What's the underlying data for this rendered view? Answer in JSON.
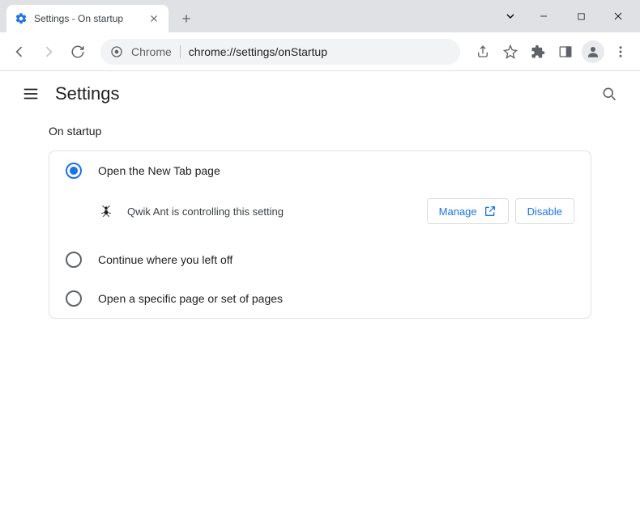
{
  "window": {
    "tab_title": "Settings - On startup"
  },
  "omnibox": {
    "prefix": "Chrome",
    "url": "chrome://settings/onStartup"
  },
  "header": {
    "title": "Settings"
  },
  "section": {
    "title": "On startup"
  },
  "options": {
    "new_tab": "Open the New Tab page",
    "continue": "Continue where you left off",
    "specific": "Open a specific page or set of pages"
  },
  "extension": {
    "notice": "Qwik Ant is controlling this setting",
    "manage": "Manage",
    "disable": "Disable"
  }
}
